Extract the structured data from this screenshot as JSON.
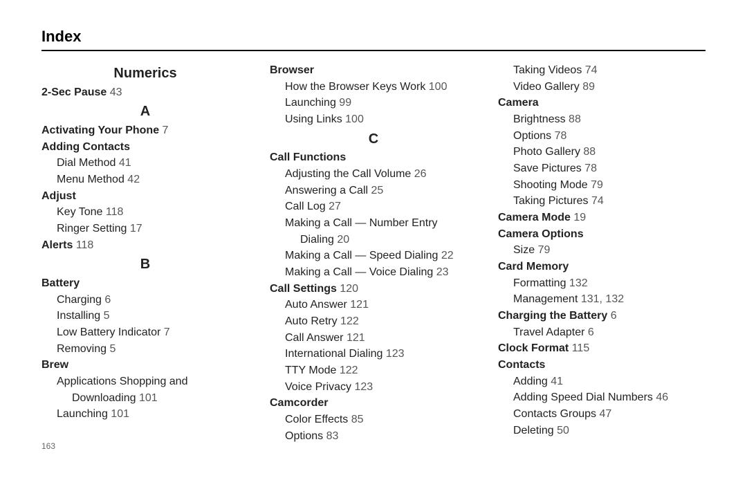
{
  "title": "Index",
  "page_number": "163",
  "col1": {
    "sec_numerics": "Numerics",
    "two_sec_pause": "2-Sec Pause",
    "two_sec_pause_pg": "43",
    "sec_a": "A",
    "activating": "Activating Your Phone",
    "activating_pg": "7",
    "adding_contacts": "Adding Contacts",
    "dial_method": "Dial Method",
    "dial_method_pg": "41",
    "menu_method": "Menu Method",
    "menu_method_pg": "42",
    "adjust": "Adjust",
    "key_tone": "Key Tone",
    "key_tone_pg": "118",
    "ringer_setting": "Ringer Setting",
    "ringer_setting_pg": "17",
    "alerts": "Alerts",
    "alerts_pg": "118",
    "sec_b": "B",
    "battery": "Battery",
    "charging": "Charging",
    "charging_pg": "6",
    "installing": "Installing",
    "installing_pg": "5",
    "low_batt": "Low Battery Indicator",
    "low_batt_pg": "7",
    "removing": "Removing",
    "removing_pg": "5",
    "brew": "Brew",
    "apps_shop_l1": "Applications Shopping and",
    "apps_shop_l2": "Downloading",
    "apps_shop_pg": "101",
    "launching_brew": "Launching",
    "launching_brew_pg": "101"
  },
  "col2": {
    "browser": "Browser",
    "browser_keys": "How the Browser Keys Work",
    "browser_keys_pg": "100",
    "launching": "Launching",
    "launching_pg": "99",
    "using_links": "Using Links",
    "using_links_pg": "100",
    "sec_c": "C",
    "call_functions": "Call Functions",
    "adjust_vol": "Adjusting the Call Volume",
    "adjust_vol_pg": "26",
    "answering": "Answering a Call",
    "answering_pg": "25",
    "call_log": "Call Log",
    "call_log_pg": "27",
    "num_entry_l1": "Making a Call — Number Entry",
    "num_entry_l2": "Dialing",
    "num_entry_pg": "20",
    "speed_dial": "Making a Call — Speed Dialing",
    "speed_dial_pg": "22",
    "voice_dial": "Making a Call — Voice Dialing",
    "voice_dial_pg": "23",
    "call_settings": "Call Settings",
    "call_settings_pg": "120",
    "auto_answer": "Auto Answer",
    "auto_answer_pg": "121",
    "auto_retry": "Auto Retry",
    "auto_retry_pg": "122",
    "call_answer": "Call Answer",
    "call_answer_pg": "121",
    "intl_dial": "International Dialing",
    "intl_dial_pg": "123",
    "tty": "TTY Mode",
    "tty_pg": "122",
    "voice_priv": "Voice Privacy",
    "voice_priv_pg": "123",
    "camcorder": "Camcorder",
    "color_fx": "Color Effects",
    "color_fx_pg": "85",
    "options": "Options",
    "options_pg": "83"
  },
  "col3": {
    "taking_videos": "Taking Videos",
    "taking_videos_pg": "74",
    "video_gallery": "Video Gallery",
    "video_gallery_pg": "89",
    "camera": "Camera",
    "brightness": "Brightness",
    "brightness_pg": "88",
    "cam_options": "Options",
    "cam_options_pg": "78",
    "photo_gallery": "Photo Gallery",
    "photo_gallery_pg": "88",
    "save_pics": "Save Pictures",
    "save_pics_pg": "78",
    "shoot_mode": "Shooting Mode",
    "shoot_mode_pg": "79",
    "taking_pics": "Taking Pictures",
    "taking_pics_pg": "74",
    "camera_mode": "Camera Mode",
    "camera_mode_pg": "19",
    "camera_options_hdr": "Camera Options",
    "size": "Size",
    "size_pg": "79",
    "card_memory": "Card Memory",
    "formatting": "Formatting",
    "formatting_pg": "132",
    "management": "Management",
    "management_pg": "131, 132",
    "charging_batt": "Charging the Battery",
    "charging_batt_pg": "6",
    "travel_adapter": "Travel Adapter",
    "travel_adapter_pg": "6",
    "clock_format": "Clock Format",
    "clock_format_pg": "115",
    "contacts": "Contacts",
    "adding": "Adding",
    "adding_pg": "41",
    "add_speed": "Adding Speed Dial Numbers",
    "add_speed_pg": "46",
    "groups": "Contacts Groups",
    "groups_pg": "47",
    "deleting": "Deleting",
    "deleting_pg": "50"
  }
}
